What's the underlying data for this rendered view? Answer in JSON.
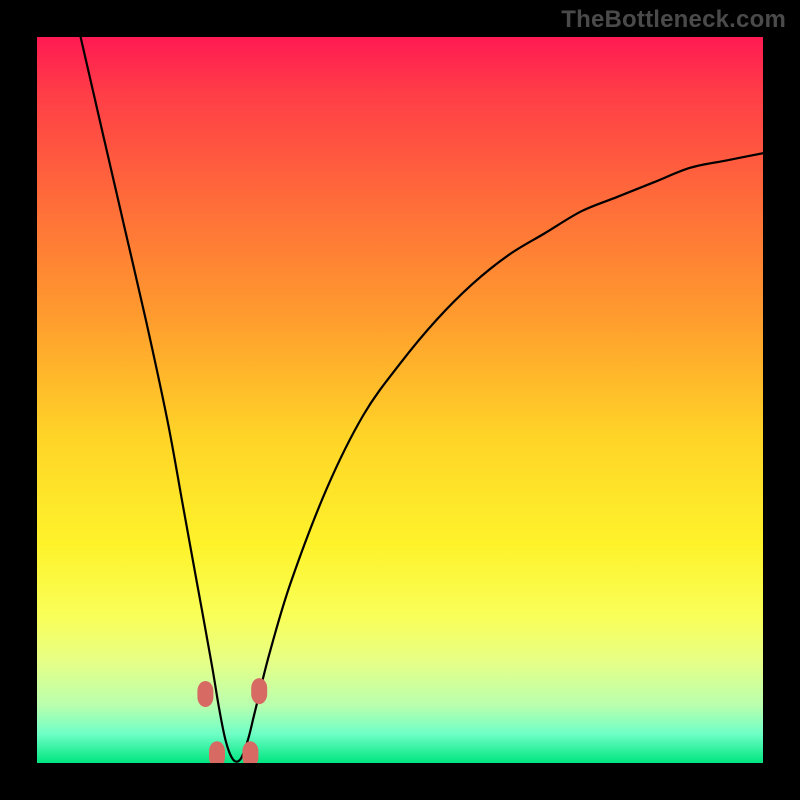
{
  "watermark": "TheBottleneck.com",
  "colors": {
    "frame": "#000000",
    "curve": "#000000",
    "marker": "#d86a64",
    "gradient_stops": [
      "#ff1a52",
      "#ff3e47",
      "#ff6a3a",
      "#ff9a2e",
      "#ffd427",
      "#fef32b",
      "#f9ff5a",
      "#e6ff86",
      "#baffae",
      "#6effc6",
      "#00e57f"
    ]
  },
  "chart_data": {
    "type": "line",
    "title": "",
    "xlabel": "",
    "ylabel": "",
    "xlim": [
      0,
      100
    ],
    "ylim": [
      0,
      100
    ],
    "grid": false,
    "legend": false,
    "minimum_x": 27,
    "series": [
      {
        "name": "bottleneck-curve",
        "x": [
          6,
          9,
          12,
          15,
          18,
          20,
          22,
          24,
          25,
          26,
          27,
          28,
          29,
          30,
          32,
          35,
          40,
          45,
          50,
          55,
          60,
          65,
          70,
          75,
          80,
          85,
          90,
          95,
          100
        ],
        "y": [
          100,
          87,
          74,
          61,
          47,
          36,
          25,
          14,
          8,
          3,
          0.5,
          0.5,
          3,
          7,
          15,
          25,
          38,
          48,
          55,
          61,
          66,
          70,
          73,
          76,
          78,
          80,
          82,
          83,
          84
        ]
      }
    ],
    "markers": [
      {
        "name": "left-upper",
        "x": 23.2,
        "y": 9.5
      },
      {
        "name": "left-lower",
        "x": 24.8,
        "y": 1.2
      },
      {
        "name": "right-lower",
        "x": 29.4,
        "y": 1.2
      },
      {
        "name": "right-upper",
        "x": 30.6,
        "y": 9.9
      }
    ]
  }
}
